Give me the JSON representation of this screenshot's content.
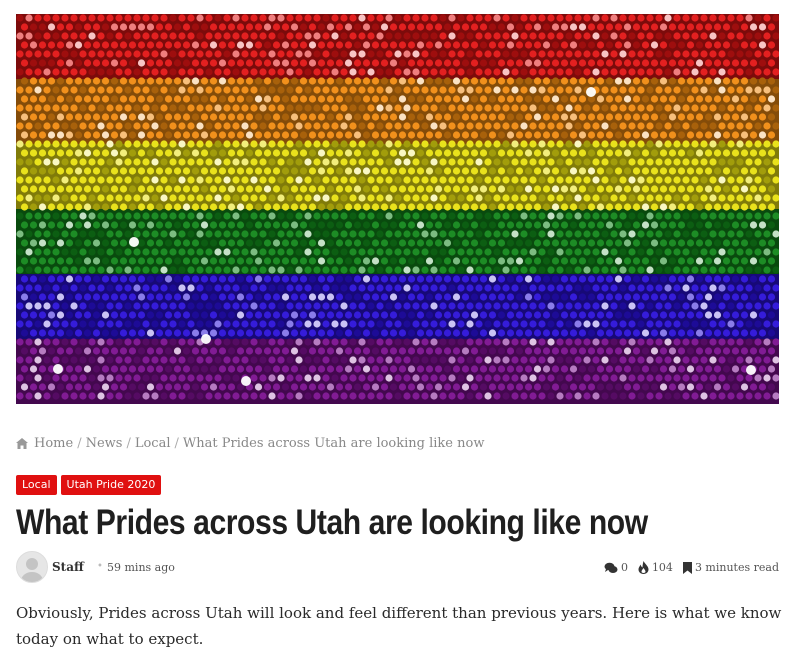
{
  "hero": {
    "alt": "Rainbow pride flag made of sequins",
    "stripes": [
      "#e11414",
      "#f08a10",
      "#e8e010",
      "#11861a",
      "#2a10d8",
      "#7a0f8e"
    ]
  },
  "breadcrumb": {
    "home": "Home",
    "news": "News",
    "local": "Local",
    "current": "What Prides across Utah are looking like now",
    "separator": "/"
  },
  "tags": [
    "Local",
    "Utah Pride 2020"
  ],
  "article": {
    "title": "What Prides across Utah are looking like now",
    "author": "Staff",
    "posted": "59 mins ago",
    "comments": "0",
    "views": "104",
    "read_time": "3 minutes read",
    "intro": "Obviously, Prides across Utah will look and feel different than previous years. Here is what we know today on what to expect."
  },
  "colors": {
    "tag_bg": "#e01010",
    "title": "#1f1f1f",
    "muted": "#888888"
  }
}
